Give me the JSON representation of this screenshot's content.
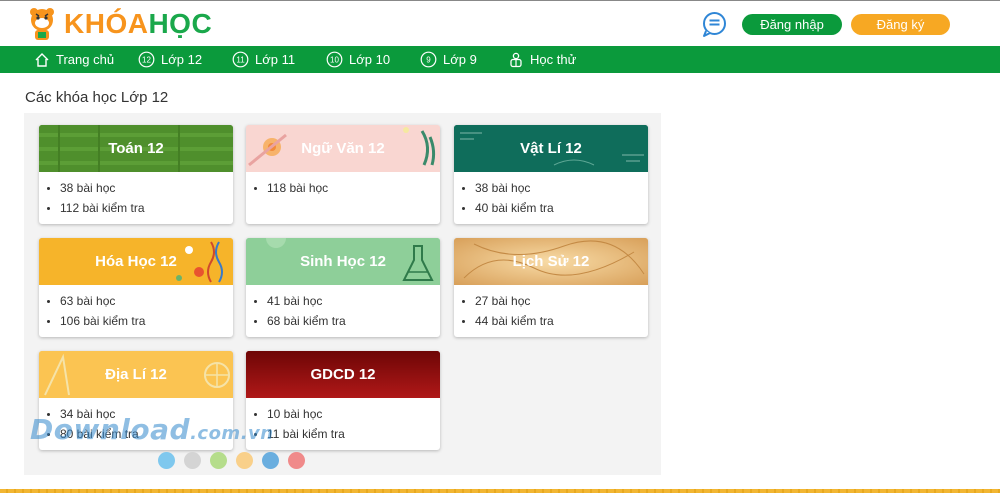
{
  "header": {
    "logo_k": "KHÓA",
    "logo_h": "HỌC",
    "login_label": "Đăng nhập",
    "register_label": "Đăng ký"
  },
  "nav": {
    "items": [
      {
        "label": "Trang chủ",
        "icon": "home-icon"
      },
      {
        "label": "Lớp 12",
        "icon": "grade-12-icon",
        "badge": "12"
      },
      {
        "label": "Lớp 11",
        "icon": "grade-11-icon",
        "badge": "11"
      },
      {
        "label": "Lớp 10",
        "icon": "grade-10-icon",
        "badge": "10"
      },
      {
        "label": "Lớp 9",
        "icon": "grade-9-icon",
        "badge": "9"
      },
      {
        "label": "Học thử",
        "icon": "trial-icon"
      }
    ]
  },
  "section": {
    "title": "Các khóa học Lớp 12"
  },
  "courses": [
    {
      "name": "Toán 12",
      "lessons": "38 bài học",
      "tests": "112 bài kiểm tra",
      "color": "#4a8a2a"
    },
    {
      "name": "Ngữ Văn 12",
      "lessons": "118 bài học",
      "tests": "",
      "color": "#f8d3cf"
    },
    {
      "name": "Vật Lí 12",
      "lessons": "38 bài học",
      "tests": "40 bài kiểm tra",
      "color": "#0e6e5a"
    },
    {
      "name": "Hóa Học 12",
      "lessons": "63 bài học",
      "tests": "106 bài kiểm tra",
      "color": "#f6b42a"
    },
    {
      "name": "Sinh Học 12",
      "lessons": "41 bài học",
      "tests": "68 bài kiểm tra",
      "color": "#8ccf98"
    },
    {
      "name": "Lịch Sử 12",
      "lessons": "27 bài học",
      "tests": "44 bài kiểm tra",
      "color": "#f0c27d"
    },
    {
      "name": "Địa Lí 12",
      "lessons": "34 bài học",
      "tests": "80 bài kiểm tra",
      "color": "#fbc24d"
    },
    {
      "name": "GDCD 12",
      "lessons": "10 bài học",
      "tests": "11 bài kiểm tra",
      "color": "#8e0c0c"
    }
  ],
  "dots": [
    "#7fc8ee",
    "#d4d4d4",
    "#b5dd8b",
    "#f9d08a",
    "#6aaedf",
    "#f08a8a"
  ],
  "watermark": {
    "main": "Download",
    "tld": ".com.vn"
  }
}
